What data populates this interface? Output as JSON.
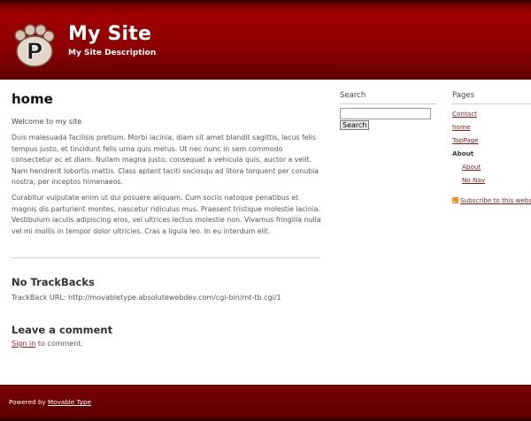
{
  "site": {
    "title": "My Site",
    "description": "My Site Description",
    "logo_letter": "P"
  },
  "main": {
    "page_title": "home",
    "welcome": "Welcome to my site",
    "paragraphs": [
      "Duis malesuada facilisis pretium. Morbi lacinia, diam sit amet blandit sagittis, lacus felis tempus justo, et tincidunt felis urna quis metus. Ut nec nunc in sem commodo consectetur ac et diam. Nullam magna justo, consequat a vehicula quis, auctor a velit. Nam hendrerit lobortis mattis. Class aptent taciti sociosqu ad litora torquent per conubia nostra, per inceptos himenaeos.",
      "Curabitur vulputate enim ut dui posuere aliquam. Cum sociis natoque penatibus et magnis dis parturient montes, nascetur ridiculus mus. Praesent tristique molestie lacinia. Vestibulum iaculis adipiscing eros, vel ultrices lectus molestie non. Vivamus fringilla nulla vel mi mollis in tempor dolor ultricies. Cras a ligula leo. In eu interdum elit."
    ],
    "trackbacks_heading": "No TrackBacks",
    "trackback_label": "TrackBack URL:",
    "trackback_url": "http://movabletype.absolutewebdev.com/cgi-bin/mt-tb.cgi/1",
    "comment_heading": "Leave a comment",
    "sign_in_label": "Sign in",
    "comment_suffix": "to comment."
  },
  "search": {
    "heading": "Search",
    "input_value": "",
    "button_label": "Search"
  },
  "pages": {
    "heading": "Pages",
    "items": [
      {
        "label": "Contact",
        "level": 0,
        "current": false
      },
      {
        "label": "home",
        "level": 0,
        "current": false
      },
      {
        "label": "TopPage",
        "level": 0,
        "current": false
      },
      {
        "label": "About",
        "level": 0,
        "current": true
      },
      {
        "label": "About",
        "level": 1,
        "current": false
      },
      {
        "label": "No Nav",
        "level": 1,
        "current": false
      }
    ],
    "subscribe_label": "Subscribe to this website's feed"
  },
  "footer": {
    "powered_by": "Powered by",
    "platform": "Movable Type"
  },
  "colors": {
    "header_bg": "#8f0000",
    "link": "#8b1a1a",
    "footer_bg": "#6a0000"
  }
}
